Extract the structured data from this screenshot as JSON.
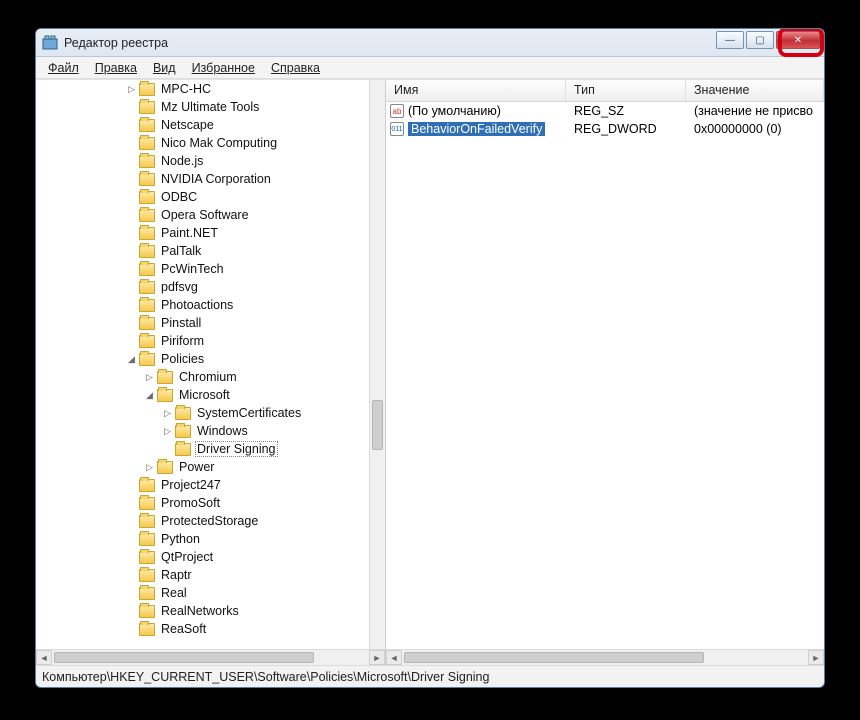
{
  "title": "Редактор реестра",
  "menus": {
    "file": "Файл",
    "edit": "Правка",
    "view": "Вид",
    "fav": "Избранное",
    "help": "Справка"
  },
  "status": "Компьютер\\HKEY_CURRENT_USER\\Software\\Policies\\Microsoft\\Driver Signing",
  "columns": {
    "name": "Имя",
    "type": "Тип",
    "value": "Значение"
  },
  "tree": [
    {
      "label": "MPC-HC",
      "depth": 5,
      "exp": "r"
    },
    {
      "label": "Mz Ultimate Tools",
      "depth": 5,
      "exp": ""
    },
    {
      "label": "Netscape",
      "depth": 5,
      "exp": ""
    },
    {
      "label": "Nico Mak Computing",
      "depth": 5,
      "exp": ""
    },
    {
      "label": "Node.js",
      "depth": 5,
      "exp": ""
    },
    {
      "label": "NVIDIA Corporation",
      "depth": 5,
      "exp": ""
    },
    {
      "label": "ODBC",
      "depth": 5,
      "exp": ""
    },
    {
      "label": "Opera Software",
      "depth": 5,
      "exp": ""
    },
    {
      "label": "Paint.NET",
      "depth": 5,
      "exp": ""
    },
    {
      "label": "PalTalk",
      "depth": 5,
      "exp": ""
    },
    {
      "label": "PcWinTech",
      "depth": 5,
      "exp": ""
    },
    {
      "label": "pdfsvg",
      "depth": 5,
      "exp": ""
    },
    {
      "label": "Photoactions",
      "depth": 5,
      "exp": ""
    },
    {
      "label": "Pinstall",
      "depth": 5,
      "exp": ""
    },
    {
      "label": "Piriform",
      "depth": 5,
      "exp": ""
    },
    {
      "label": "Policies",
      "depth": 5,
      "exp": "d"
    },
    {
      "label": "Chromium",
      "depth": 6,
      "exp": "r"
    },
    {
      "label": "Microsoft",
      "depth": 6,
      "exp": "d"
    },
    {
      "label": "SystemCertificates",
      "depth": 7,
      "exp": "r"
    },
    {
      "label": "Windows",
      "depth": 7,
      "exp": "r"
    },
    {
      "label": "Driver Signing",
      "depth": 7,
      "exp": "",
      "selected": true
    },
    {
      "label": "Power",
      "depth": 6,
      "exp": "r"
    },
    {
      "label": "Project247",
      "depth": 5,
      "exp": ""
    },
    {
      "label": "PromoSoft",
      "depth": 5,
      "exp": ""
    },
    {
      "label": "ProtectedStorage",
      "depth": 5,
      "exp": ""
    },
    {
      "label": "Python",
      "depth": 5,
      "exp": ""
    },
    {
      "label": "QtProject",
      "depth": 5,
      "exp": ""
    },
    {
      "label": "Raptr",
      "depth": 5,
      "exp": ""
    },
    {
      "label": "Real",
      "depth": 5,
      "exp": ""
    },
    {
      "label": "RealNetworks",
      "depth": 5,
      "exp": ""
    },
    {
      "label": "ReaSoft",
      "depth": 5,
      "exp": ""
    }
  ],
  "values": [
    {
      "name": "(По умолчанию)",
      "type": "REG_SZ",
      "val": "(значение не присво",
      "icon": "ab",
      "selected": false
    },
    {
      "name": "BehaviorOnFailedVerify",
      "type": "REG_DWORD",
      "val": "0x00000000 (0)",
      "icon": "bin",
      "selected": true
    }
  ]
}
